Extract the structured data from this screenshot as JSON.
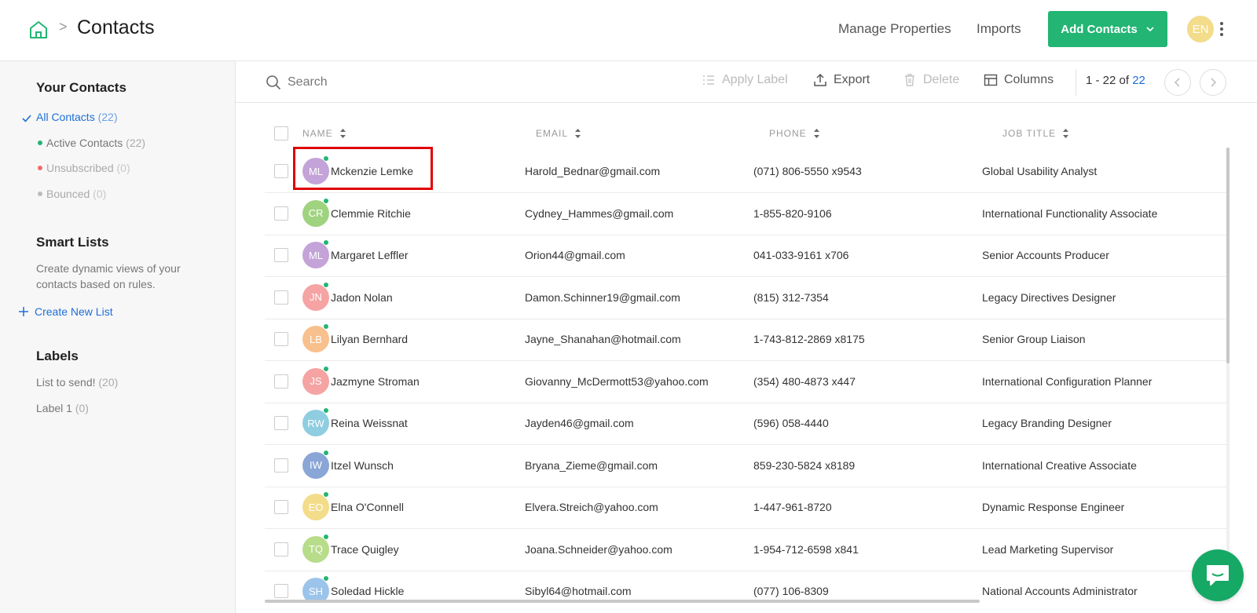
{
  "header": {
    "breadcrumb_separator": ">",
    "title": "Contacts",
    "manage_properties": "Manage Properties",
    "imports": "Imports",
    "add_contacts": "Add Contacts",
    "user_initials": "EN"
  },
  "sidebar": {
    "your_contacts_heading": "Your Contacts",
    "items": [
      {
        "label": "All Contacts",
        "count": "(22)"
      },
      {
        "label": "Active Contacts",
        "count": "(22)"
      },
      {
        "label": "Unsubscribed",
        "count": "(0)"
      },
      {
        "label": "Bounced",
        "count": "(0)"
      }
    ],
    "smart_lists_heading": "Smart Lists",
    "smart_lists_desc": "Create dynamic views of your contacts based on rules.",
    "create_new_list": "Create New List",
    "labels_heading": "Labels",
    "labels": [
      {
        "label": "List to send!",
        "count": "(20)"
      },
      {
        "label": "Label 1",
        "count": "(0)"
      }
    ]
  },
  "toolbar": {
    "search_placeholder": "Search",
    "apply_label": "Apply Label",
    "export": "Export",
    "delete": "Delete",
    "columns": "Columns",
    "pager_range": "1 - 22 of ",
    "pager_total": "22"
  },
  "table": {
    "columns": [
      "NAME",
      "EMAIL",
      "PHONE",
      "JOB TITLE"
    ],
    "rows": [
      {
        "initials": "ML",
        "color": "#c3a3d8",
        "name": "Mckenzie Lemke",
        "email": "Harold_Bednar@gmail.com",
        "phone": "(071) 806-5550 x9543",
        "job": "Global Usability Analyst"
      },
      {
        "initials": "CR",
        "color": "#9fd37f",
        "name": "Clemmie Ritchie",
        "email": "Cydney_Hammes@gmail.com",
        "phone": "1-855-820-9106",
        "job": "International Functionality Associate"
      },
      {
        "initials": "ML",
        "color": "#c3a3d8",
        "name": "Margaret Leffler",
        "email": "Orion44@gmail.com",
        "phone": "041-033-9161 x706",
        "job": "Senior Accounts Producer"
      },
      {
        "initials": "JN",
        "color": "#f5a3a3",
        "name": "Jadon Nolan",
        "email": "Damon.Schinner19@gmail.com",
        "phone": "(815) 312-7354",
        "job": "Legacy Directives Designer"
      },
      {
        "initials": "LB",
        "color": "#f8c08d",
        "name": "Lilyan Bernhard",
        "email": "Jayne_Shanahan@hotmail.com",
        "phone": "1-743-812-2869 x8175",
        "job": "Senior Group Liaison"
      },
      {
        "initials": "JS",
        "color": "#f5a3a3",
        "name": "Jazmyne Stroman",
        "email": "Giovanny_McDermott53@yahoo.com",
        "phone": "(354) 480-4873 x447",
        "job": "International Configuration Planner"
      },
      {
        "initials": "RW",
        "color": "#8fcde0",
        "name": "Reina Weissnat",
        "email": "Jayden46@gmail.com",
        "phone": "(596) 058-4440",
        "job": "Legacy Branding Designer"
      },
      {
        "initials": "IW",
        "color": "#8aa6d6",
        "name": "Itzel Wunsch",
        "email": "Bryana_Zieme@gmail.com",
        "phone": "859-230-5824 x8189",
        "job": "International Creative Associate"
      },
      {
        "initials": "EO",
        "color": "#f3dc8a",
        "name": "Elna O'Connell",
        "email": "Elvera.Streich@yahoo.com",
        "phone": "1-447-961-8720",
        "job": "Dynamic Response Engineer"
      },
      {
        "initials": "TQ",
        "color": "#b7dc8a",
        "name": "Trace Quigley",
        "email": "Joana.Schneider@yahoo.com",
        "phone": "1-954-712-6598 x841",
        "job": "Lead Marketing Supervisor"
      },
      {
        "initials": "SH",
        "color": "#9cc4ea",
        "name": "Soledad Hickle",
        "email": "Sibyl64@hotmail.com",
        "phone": "(077) 106-8309",
        "job": "National Accounts Administrator"
      }
    ]
  }
}
